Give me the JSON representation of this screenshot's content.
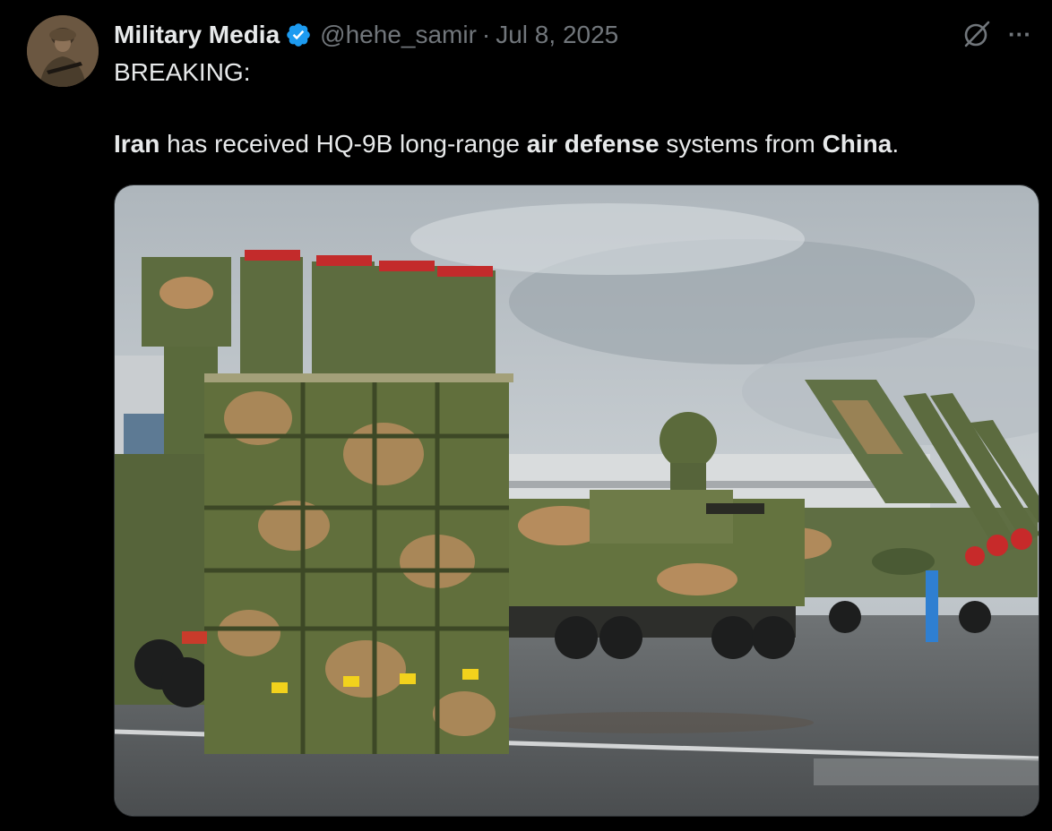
{
  "post": {
    "author_name": "Military Media",
    "verified": true,
    "handle": "@hehe_samir",
    "separator": "·",
    "date": "Jul 8, 2025",
    "line1": "BREAKING:",
    "body_parts": [
      {
        "text": "Iran",
        "bold": true
      },
      {
        "text": " has received HQ-9B long-range ",
        "bold": false
      },
      {
        "text": "air defense",
        "bold": true
      },
      {
        "text": " systems from ",
        "bold": false
      },
      {
        "text": "China",
        "bold": true
      },
      {
        "text": ".",
        "bold": false
      }
    ],
    "more_label": "···"
  },
  "icons": {
    "verified": "verified-badge-icon",
    "grok": "grok-icon",
    "more": "more-icon"
  },
  "colors": {
    "background": "#000000",
    "text": "#e7e9ea",
    "muted": "#71767b",
    "verified": "#1d9bf0"
  }
}
